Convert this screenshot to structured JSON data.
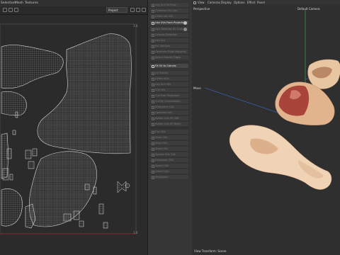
{
  "uv_editor": {
    "menu": [
      "Selection",
      "Mesh",
      "Textures"
    ],
    "object_select": "Project",
    "tick_u": "1.0",
    "tick_v": "1.0"
  },
  "panel": {
    "items": [
      "Lay Out UV Flow",
      "Combine UV Cuts",
      "Unfold All UVs",
      "Use UVs From Projection",
      "Use Selected UV Cuts",
      "Unwrap Selection",
      "Lay Out",
      "Pin Vertices",
      "Generate Edge Mapping",
      "Select Border Edges",
      "Fit UV to Canvas",
      "UV Border",
      "Unfold UVs",
      "Lay Out UVs",
      "Cut UVs",
      "Cut Prior Projection",
      "Cut By Connectivity",
      "Straighten UVs",
      "Optimize UVs",
      "Rotate UVs 90 Left",
      "Rotate UVs 90 Right",
      "Flip UVs",
      "Snap UVs",
      "Align UVs",
      "Stack UVs",
      "Spread UVs Out",
      "Distribute UVs",
      "Space UVs",
      "Orient UVs",
      "Straighten"
    ]
  },
  "viewport": {
    "menu": [
      "View",
      "Cameras",
      "Display",
      "Options",
      "Effect",
      "Panel"
    ],
    "perspective_label": "Perspective",
    "camera_label": "Default Camera",
    "axis_label": "Move",
    "status": "View Transform: Scene"
  }
}
